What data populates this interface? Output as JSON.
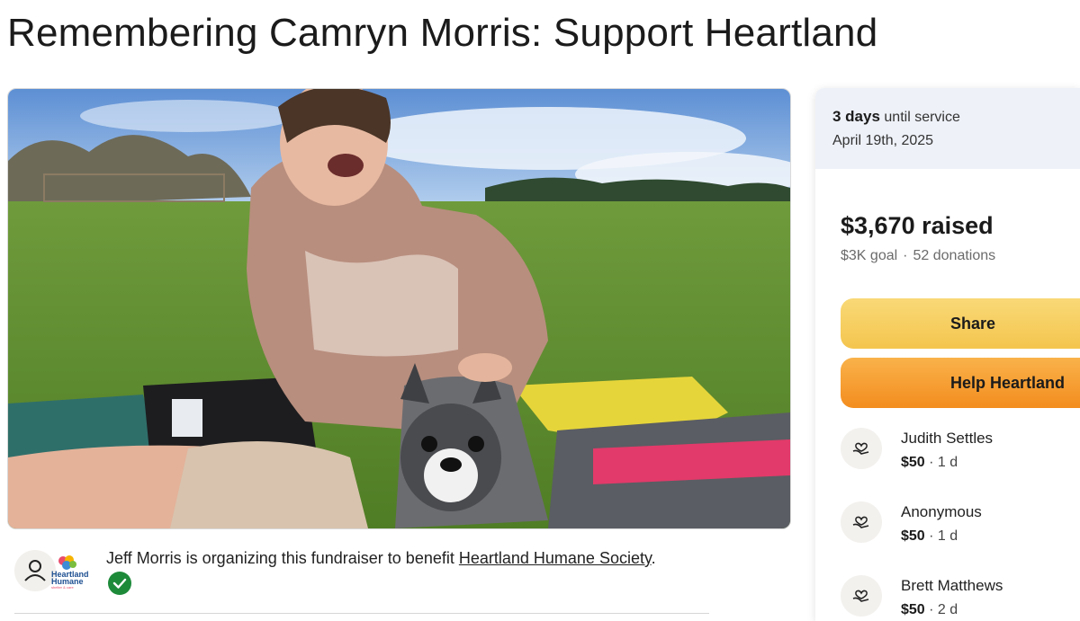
{
  "page": {
    "title": "Remembering Camryn Morris: Support Heartland"
  },
  "organizer": {
    "text_prefix": "Jeff Morris is organizing this fundraiser to benefit ",
    "beneficiary_link": "Heartland Humane Society",
    "text_suffix": ".",
    "logo_text_line1": "Heartland",
    "logo_text_line2": "Humane",
    "logo_text_line3": "shelter & care",
    "verified_icon": "check-circle-icon",
    "avatar_icon": "user-icon"
  },
  "sidebar": {
    "countdown_value": "3 days",
    "countdown_label": "until service",
    "service_date": "April 19th, 2025",
    "raised": "$3,670 raised",
    "goal": "$3K goal",
    "separator": "·",
    "donations_count": "52 donations",
    "share_label": "Share",
    "help_label": "Help Heartland",
    "donations": [
      {
        "name": "Judith Settles",
        "amount": "$50",
        "time": "1 d",
        "icon": "heart-hand-icon"
      },
      {
        "name": "Anonymous",
        "amount": "$50",
        "time": "1 d",
        "icon": "heart-hand-icon"
      },
      {
        "name": "Brett Matthews",
        "amount": "$50",
        "time": "2 d",
        "icon": "heart-hand-icon"
      }
    ]
  },
  "colors": {
    "share_button": "#f4c54e",
    "help_button": "#f38d1f",
    "verified": "#1d8a3a",
    "countdown_bg": "#eef1f8"
  }
}
